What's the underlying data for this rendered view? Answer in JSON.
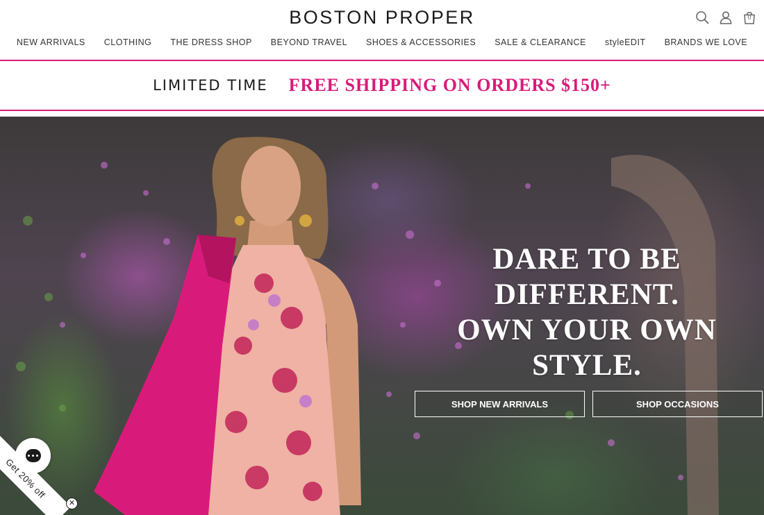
{
  "header": {
    "logo": "BOSTON PROPER",
    "cart_count": "0",
    "icons": [
      "search-icon",
      "account-icon",
      "cart-icon"
    ]
  },
  "nav": {
    "items": [
      "NEW ARRIVALS",
      "CLOTHING",
      "THE DRESS SHOP",
      "BEYOND TRAVEL",
      "SHOES & ACCESSORIES",
      "SALE & CLEARANCE",
      "styleEDIT",
      "BRANDS WE LOVE"
    ]
  },
  "promo": {
    "limited": "LIMITED TIME",
    "offer": "FREE SHIPPING ON ORDERS $150+",
    "accent_color": "#d81b7a"
  },
  "hero": {
    "headline_line1": "DARE TO BE",
    "headline_line2": "DIFFERENT.",
    "headline_line3": "OWN YOUR OWN",
    "headline_line4": "STYLE.",
    "button_arrivals": "SHOP NEW ARRIVALS",
    "button_occasions": "SHOP OCCASIONS"
  },
  "widgets": {
    "discount_label": "Get 20% off",
    "close_symbol": "✕"
  }
}
